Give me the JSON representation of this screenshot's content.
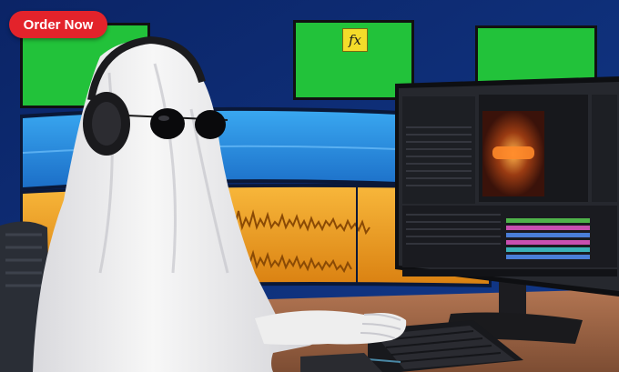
{
  "cta": {
    "label": "Order Now"
  },
  "fx_badge": {
    "label": "fx"
  },
  "colors": {
    "wall": "#0d2a6e",
    "cta_red": "#e3232b",
    "green_screen": "#22c23a",
    "blue_panel": "#1f8fe0",
    "orange_panel": "#f0a020",
    "desk": "#a0694a",
    "ghost_sheet": "#f2f2f2"
  },
  "icons": [
    "headphones-icon",
    "sunglasses-icon",
    "keyboard-icon",
    "mouse-icon",
    "monitor-icon"
  ]
}
